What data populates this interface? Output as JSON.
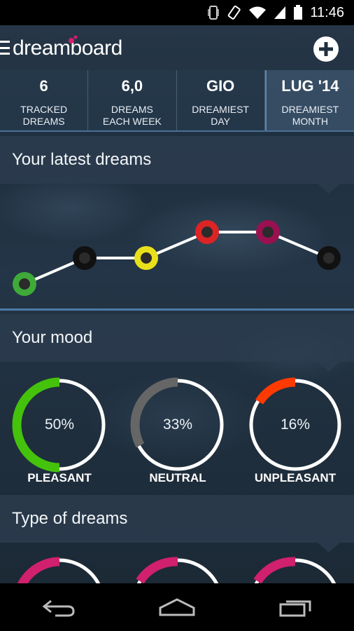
{
  "status_bar": {
    "time": "11:46",
    "icons": [
      "vibrate-icon",
      "rotate-icon",
      "wifi-icon",
      "signal-icon",
      "battery-icon"
    ]
  },
  "header": {
    "logo_text": "dreamboard",
    "menu_icon": "hamburger-icon",
    "add_icon": "plus-icon"
  },
  "stats": [
    {
      "value": "6",
      "label": "TRACKED\nDREAMS"
    },
    {
      "value": "6,0",
      "label": "DREAMS\nEACH WEEK"
    },
    {
      "value": "GIO",
      "label": "DREAMIEST\nDAY"
    },
    {
      "value": "LUG '14",
      "label": "DREAMIEST\nMONTH"
    }
  ],
  "sections": {
    "latest": "Your latest dreams",
    "mood": "Your mood",
    "types": "Type of dreams"
  },
  "colors": {
    "accent_line": "#4c7aa8",
    "pleasant": "#44c20c",
    "neutral": "#666666",
    "unpleasant": "#ff3a00",
    "type_ring": "#d0206e"
  },
  "chart_data": {
    "type": "line",
    "points": [
      {
        "index": 1,
        "level": 1,
        "color": "#3faa3a"
      },
      {
        "index": 2,
        "level": 2,
        "color": "#111111"
      },
      {
        "index": 3,
        "level": 2,
        "color": "#e8e01a"
      },
      {
        "index": 4,
        "level": 3,
        "color": "#dd2424"
      },
      {
        "index": 5,
        "level": 3,
        "color": "#9a1050"
      },
      {
        "index": 6,
        "level": 2,
        "color": "#111111"
      }
    ]
  },
  "mood": [
    {
      "percent": "50%",
      "fraction": 0.5,
      "label": "PLEASANT",
      "color": "#44c20c"
    },
    {
      "percent": "33%",
      "fraction": 0.33,
      "label": "NEUTRAL",
      "color": "#666666"
    },
    {
      "percent": "16%",
      "fraction": 0.16,
      "label": "UNPLEASANT",
      "color": "#ff3a00"
    }
  ],
  "nav": {
    "back": "back-icon",
    "home": "home-icon",
    "recents": "recents-icon"
  }
}
